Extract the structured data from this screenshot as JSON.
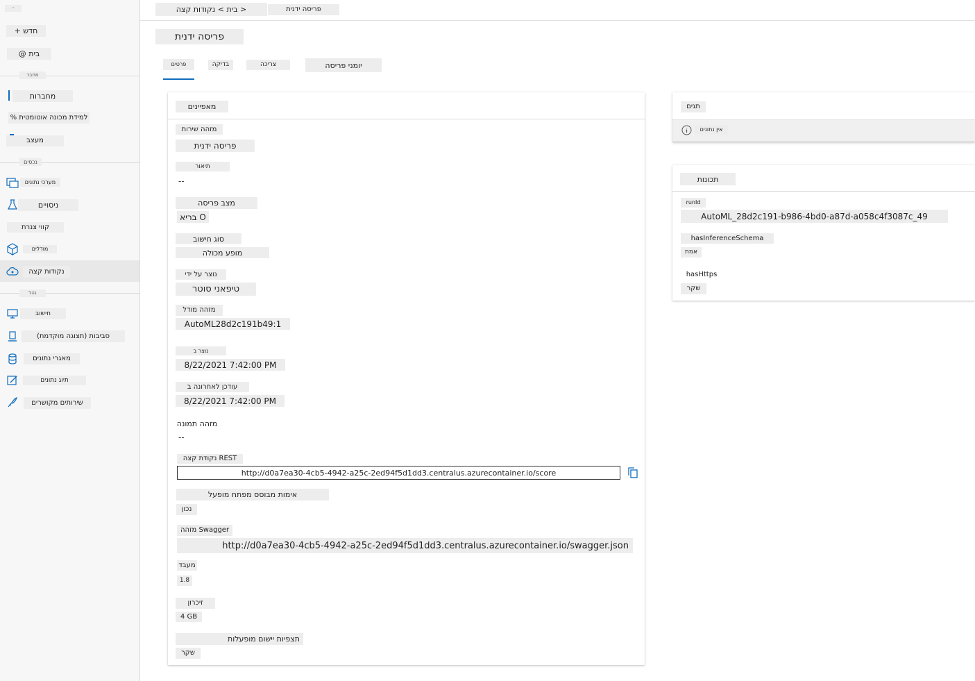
{
  "sidebar": {
    "collapse_label": "·",
    "new_label": "+ חדש",
    "home_label": "@ בית",
    "section_author": "מחבר",
    "notebooks": "מחברות",
    "automl": "% למידת מכונה אוטומטית",
    "designer": "מעצב",
    "section_assets": "נכסים",
    "datasets": "מערכי נתונים",
    "experiments": "ניסויים",
    "pipelines": "קווי צנרת",
    "models": "מודלים",
    "endpoints": "נקודות קצה",
    "section_manage": "נהל",
    "compute": "חישוב",
    "environments": "סביבות (תצוגה מוקדמת)",
    "datastores": "מאגרי נתונים",
    "labeling": "תיוג נתונים",
    "linked_services": "שירותים מקושרים"
  },
  "breadcrumb": {
    "path": "בית > נקודות קצה >",
    "current": "פריסה ידנית"
  },
  "page": {
    "title": "פריסה ידנית"
  },
  "tabs": [
    "פרטים",
    "בדיקה",
    "צריכה",
    "יומני פריסה"
  ],
  "attributes": {
    "header": "מאפיינים",
    "fields": {
      "service_id_label": "מזהה שירות",
      "service_id_value": "פריסה ידנית",
      "description_label": "תיאור",
      "description_value": "--",
      "deploy_state_label": "מצב פריסה",
      "deploy_state_value": "בריא O",
      "compute_type_label": "סוג חישוב",
      "compute_type_value": "מופע מכולה",
      "created_by_label": "נוצר על ידי",
      "created_by_value": "טיפאני סוטר",
      "model_id_label": "מזהה מודל",
      "model_id_value": "AutoML28d2c191b49:1",
      "created_on_label": "נוצר ב",
      "created_on_value": "8/22/2021 7:42:00 PM",
      "updated_label": "עודכן לאחרונה ב",
      "updated_value": "8/22/2021 7:42:00 PM",
      "image_id_label": "מזהה תמונה",
      "image_id_value": "--",
      "rest_label": "נקודת קצה REST",
      "rest_value": "http://d0a7ea30-4cb5-4942-a25c-2ed94f5d1dd3.centralus.azurecontainer.io/score",
      "key_auth_label": "אימות מבוסס מפתח מופעל",
      "key_auth_value": "נכון",
      "swagger_label": "מזהה Swagger",
      "swagger_value": "http://d0a7ea30-4cb5-4942-a25c-2ed94f5d1dd3.centralus.azurecontainer.io/swagger.json",
      "cpu_label": "מעבד",
      "cpu_value": "1.8",
      "memory_label": "זיכרון",
      "memory_value": "4 GB",
      "insights_label": "תצפיות יישום מופעלות",
      "insights_value": "שקר"
    }
  },
  "tags": {
    "header": "תגים",
    "empty": "אין נתונים"
  },
  "properties": {
    "header": "תכונות",
    "runid_label": "runId",
    "runid_value": "AutoML_28d2c191-b986-4bd0-a87d-a058c4f3087c_49",
    "schema_label": "hasInferenceSchema",
    "schema_value": "אמת",
    "https_label": "hasHttps",
    "https_value": "שקר"
  }
}
